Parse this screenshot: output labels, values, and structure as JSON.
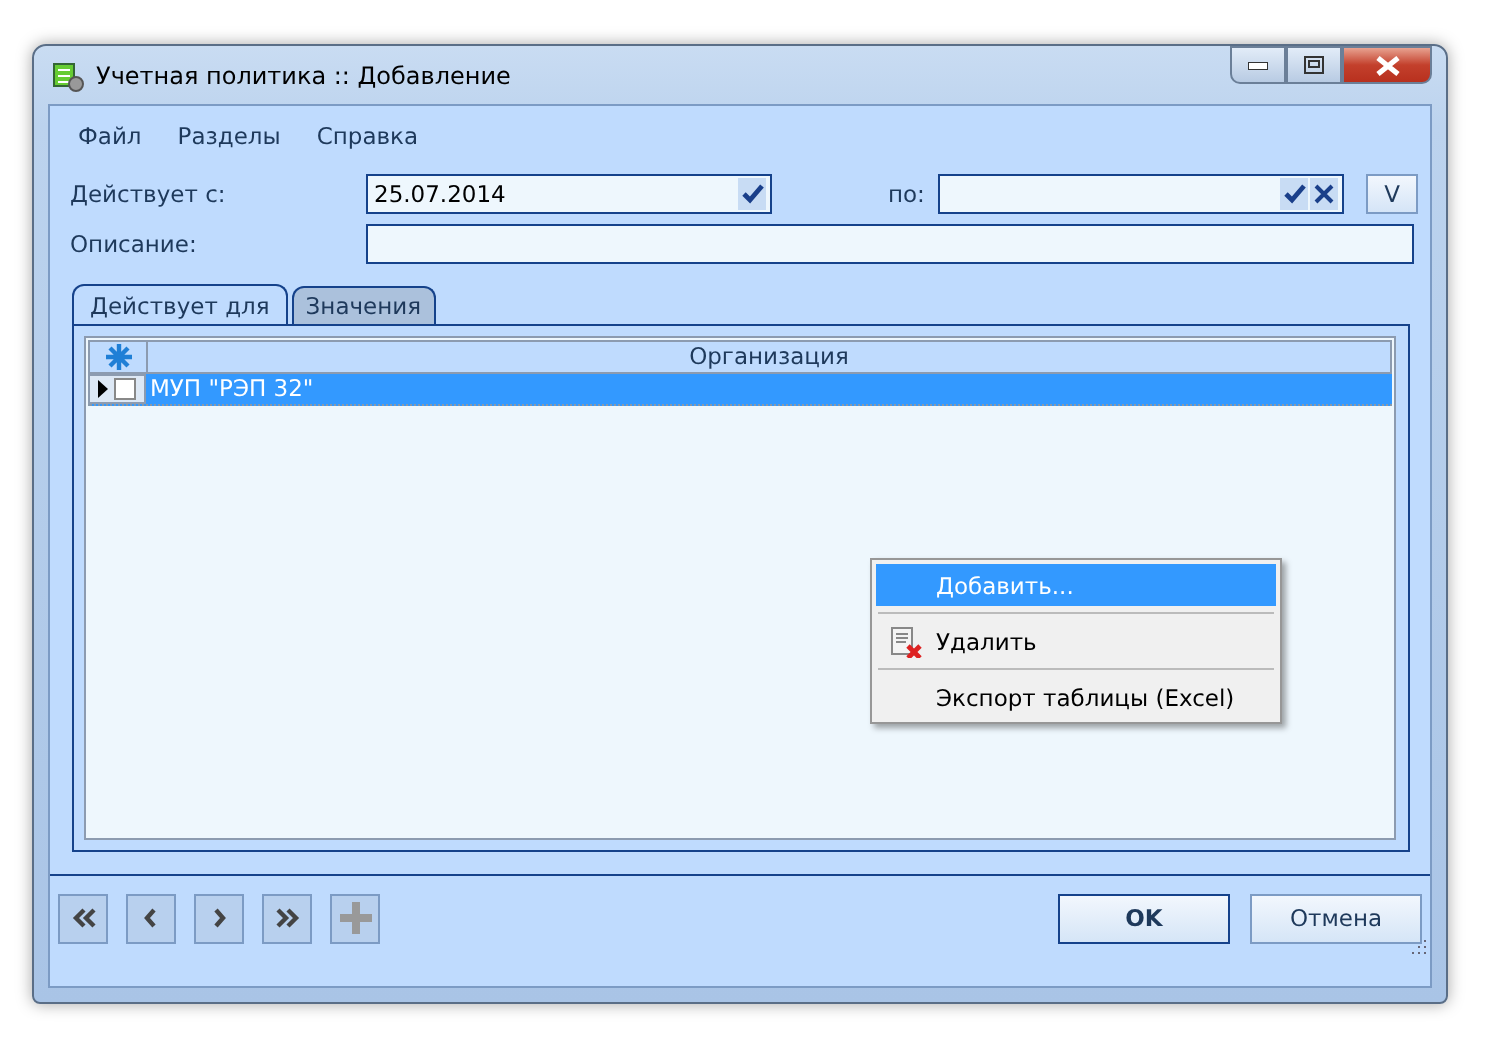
{
  "window": {
    "title": "Учетная политика :: Добавление"
  },
  "menu": [
    "Файл",
    "Разделы",
    "Справка"
  ],
  "valid_from": {
    "label": "Действует с:",
    "value": "25.07.2014"
  },
  "valid_to": {
    "label": "по:"
  },
  "v_button": "V",
  "description": {
    "label": "Описание:"
  },
  "tabs": [
    {
      "label": "Действует для",
      "selected": true
    },
    {
      "label": "Значения",
      "selected": false
    }
  ],
  "grid": {
    "columns": [
      "Организация"
    ],
    "rows": [
      {
        "cells": [
          "МУП \"РЭП 32\""
        ],
        "selected": true,
        "checked": false,
        "current": true
      }
    ]
  },
  "context_menu": [
    {
      "kind": "item",
      "label": "Добавить...",
      "selected": true
    },
    {
      "kind": "separator"
    },
    {
      "kind": "delete_item",
      "label": "Удалить",
      "selected": false
    },
    {
      "kind": "separator"
    },
    {
      "kind": "item",
      "label": "Экспорт таблицы (Excel)",
      "selected": false
    }
  ],
  "nav_buttons": [
    {
      "kind": "first",
      "disabled": false
    },
    {
      "kind": "prev",
      "disabled": false
    },
    {
      "kind": "next",
      "disabled": false
    },
    {
      "kind": "last",
      "disabled": false
    },
    {
      "kind": "add",
      "disabled": true
    }
  ],
  "dialog_buttons": [
    {
      "label": "OK",
      "default": true
    },
    {
      "label": "Отмена",
      "default": false
    }
  ]
}
